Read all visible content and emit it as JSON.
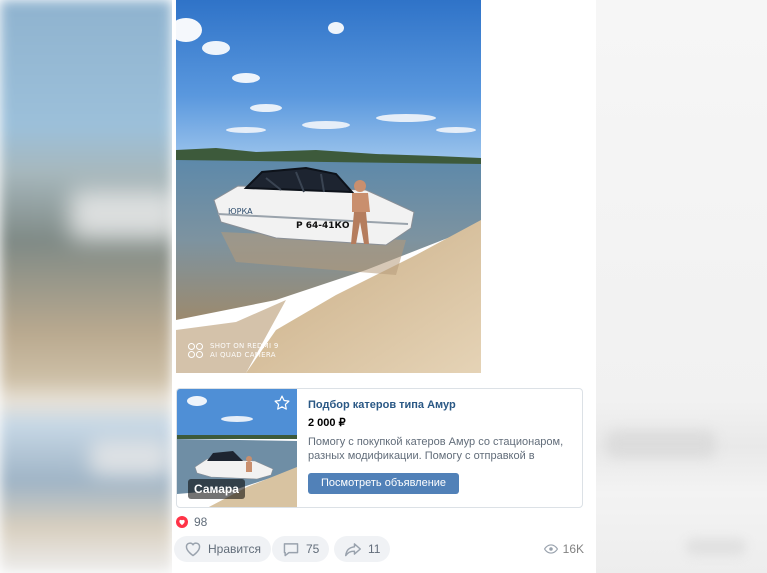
{
  "photo": {
    "boat_name": "ЮРКА",
    "boat_number": "Р 64-41КО",
    "watermark": {
      "line1": "SHOT ON REDMI 9",
      "line2": "AI QUAD CAMERA"
    }
  },
  "listing": {
    "title": "Подбор катеров типа Амур",
    "price": "2 000 ₽",
    "description": "Помогу с покупкой катеров Амур со стационаром, разных модификации. Помогу с отправкой в друго…",
    "button_label": "Посмотреть объявление",
    "city": "Самара",
    "favorite_icon": "star-outline-icon"
  },
  "reactions": {
    "icon": "heart-icon",
    "count": "98"
  },
  "actions": {
    "like": {
      "icon": "heart-outline-icon",
      "label": "Нравится"
    },
    "comment": {
      "icon": "comment-icon",
      "count": "75"
    },
    "share": {
      "icon": "share-icon",
      "count": "11"
    },
    "views": {
      "icon": "eye-icon",
      "count": "16K"
    }
  },
  "colors": {
    "link": "#2a5885",
    "button": "#5181b8",
    "reaction": "#ff3347",
    "muted_text": "#626d7a",
    "action_bg": "#f0f2f5"
  }
}
